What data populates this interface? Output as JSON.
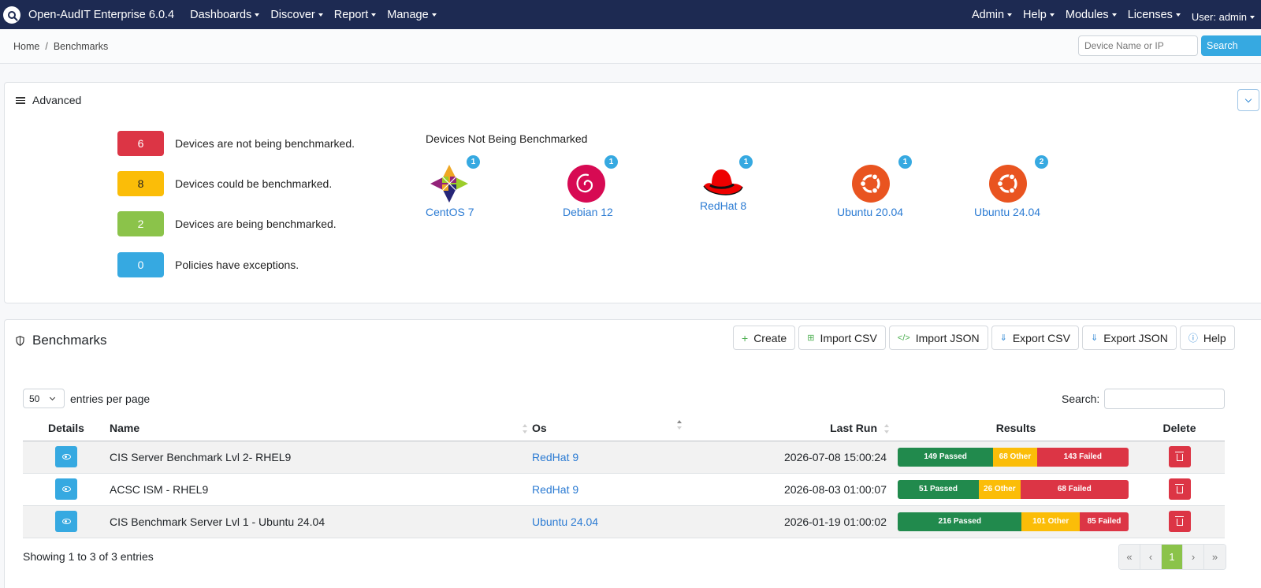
{
  "app": {
    "title": "Open-AudIT Enterprise 6.0.4",
    "menu": [
      "Dashboards",
      "Discover",
      "Report",
      "Manage"
    ],
    "right_menu": [
      "Admin",
      "Help",
      "Modules",
      "Licenses"
    ],
    "user": "User: admin"
  },
  "breadcrumb": {
    "home": "Home",
    "separator": "/",
    "current": "Benchmarks"
  },
  "device_search": {
    "placeholder": "Device Name or IP",
    "button": "Search"
  },
  "advanced": {
    "title": "Advanced",
    "stats": [
      {
        "count": "6",
        "label": "Devices are not being benchmarked.",
        "color": "#dc3545"
      },
      {
        "count": "8",
        "label": "Devices could be benchmarked.",
        "color": "#fbbd08"
      },
      {
        "count": "2",
        "label": "Devices are being benchmarked.",
        "color": "#8bc34a"
      },
      {
        "count": "0",
        "label": "Policies have exceptions.",
        "color": "#36a9e1"
      }
    ],
    "not_benchmarked_title": "Devices Not Being Benchmarked",
    "os_tiles": [
      {
        "name": "CentOS 7",
        "count": "1",
        "icon": "centos-icon"
      },
      {
        "name": "Debian 12",
        "count": "1",
        "icon": "debian-icon"
      },
      {
        "name": "RedHat 8",
        "count": "1",
        "icon": "redhat-icon"
      },
      {
        "name": "Ubuntu 20.04",
        "count": "1",
        "icon": "ubuntu-icon"
      },
      {
        "name": "Ubuntu 24.04",
        "count": "2",
        "icon": "ubuntu-icon"
      }
    ]
  },
  "benchmarks": {
    "title": "Benchmarks",
    "toolbar": {
      "create": "Create",
      "import_csv": "Import CSV",
      "import_json": "Import JSON",
      "export_csv": "Export CSV",
      "export_json": "Export JSON",
      "help": "Help"
    },
    "per_page_value": "50",
    "per_page_label": "entries per page",
    "search_label": "Search:",
    "columns": {
      "details": "Details",
      "name": "Name",
      "os": "Os",
      "last_run": "Last Run",
      "results": "Results",
      "delete": "Delete"
    },
    "rows": [
      {
        "name": "CIS Server Benchmark Lvl 2- RHEL9",
        "os": "RedHat 9",
        "last_run": "2026-07-08 15:00:24",
        "passed": 149,
        "other": 68,
        "failed": 143,
        "passed_label": "149 Passed",
        "other_label": "68 Other",
        "failed_label": "143 Failed"
      },
      {
        "name": "ACSC ISM - RHEL9",
        "os": "RedHat 9",
        "last_run": "2026-08-03 01:00:07",
        "passed": 51,
        "other": 26,
        "failed": 68,
        "passed_label": "51 Passed",
        "other_label": "26 Other",
        "failed_label": "68 Failed"
      },
      {
        "name": "CIS Benchmark Server Lvl 1 - Ubuntu 24.04",
        "os": "Ubuntu 24.04",
        "last_run": "2026-01-19 01:00:02",
        "passed": 216,
        "other": 101,
        "failed": 85,
        "passed_label": "216 Passed",
        "other_label": "101 Other",
        "failed_label": "85 Failed"
      }
    ],
    "info": "Showing 1 to 3 of 3 entries",
    "pager": {
      "first": "«",
      "prev": "‹",
      "page": "1",
      "next": "›",
      "last": "»"
    }
  }
}
